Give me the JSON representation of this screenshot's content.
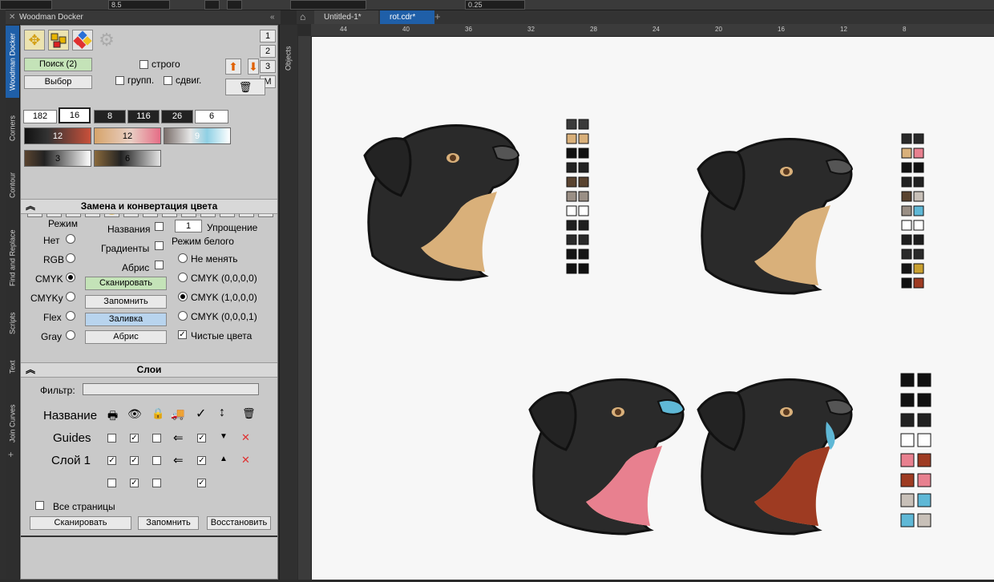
{
  "toolbar": {
    "size_value": "8.5",
    "outline_value": "0.25"
  },
  "docker": {
    "title": "Woodman Docker",
    "side_tabs": [
      "Woodman Docker",
      "Corners",
      "Contour",
      "Find and Replace",
      "Scripts",
      "Text",
      "Join Curves"
    ],
    "right_tab": "Objects",
    "page_buttons": [
      "1",
      "2",
      "3",
      "M"
    ],
    "search_button": "Поиск (2)",
    "select_button": "Выбор",
    "strict_label": "строго",
    "group_label": "групп.",
    "shift_label": "сдвиг.",
    "number_boxes": [
      "182",
      "16",
      "8",
      "116",
      "26",
      "6"
    ],
    "gradient_values": [
      "12",
      "12",
      "9",
      "3",
      "6"
    ],
    "color_section": {
      "title": "Замена и конвертация цвета",
      "mode_label": "Режим",
      "modes": [
        "Нет",
        "RGB",
        "CMYK",
        "CMYKy",
        "Flex",
        "Gray"
      ],
      "selected_mode": "CMYK",
      "names_label": "Названия",
      "gradients_label": "Градиенты",
      "outline_label": "Абрис",
      "simplify_value": "1",
      "simplify_label": "Упрощение",
      "white_mode_label": "Режим белого",
      "white_options": [
        "Не менять",
        "CMYK (0,0,0,0)",
        "CMYK (1,0,0,0)",
        "CMYK (0,0,0,1)"
      ],
      "selected_white": "CMYK (1,0,0,0)",
      "pure_colors_label": "Чистые цвета",
      "scan_button": "Сканировать",
      "remember_button": "Запомнить",
      "fill_button": "Заливка",
      "outline_button": "Абрис"
    },
    "layers_section": {
      "title": "Слои",
      "filter_label": "Фильтр:",
      "filter_value": "",
      "name_header": "Название",
      "rows": [
        {
          "name": "Guides",
          "print": false,
          "visible": true,
          "lock": false,
          "arrow": "⇐",
          "check": true,
          "order": "▼",
          "delete": "✕"
        },
        {
          "name": "Слой 1",
          "print": true,
          "visible": true,
          "lock": false,
          "arrow": "⇐",
          "check": true,
          "order": "▲",
          "delete": "✕"
        },
        {
          "name": "",
          "print": false,
          "visible": true,
          "lock": false,
          "arrow": "",
          "check": true,
          "order": "",
          "delete": ""
        }
      ],
      "all_pages_label": "Все страницы",
      "scan_button": "Сканировать",
      "remember_button": "Запомнить",
      "restore_button": "Восстановить"
    }
  },
  "document_tabs": [
    "Untitled-1*",
    "rot.cdr*"
  ],
  "active_tab": "rot.cdr*",
  "ruler_labels": [
    "44",
    "40",
    "36",
    "32",
    "28",
    "24",
    "20",
    "16",
    "12",
    "8"
  ],
  "colors": {
    "accent": "#1f5fa8",
    "tan": "#d9b07a",
    "pink": "#e8808f",
    "blue": "#5fb8d6",
    "rust": "#9e3b22",
    "dark": "#2a2a2a"
  }
}
